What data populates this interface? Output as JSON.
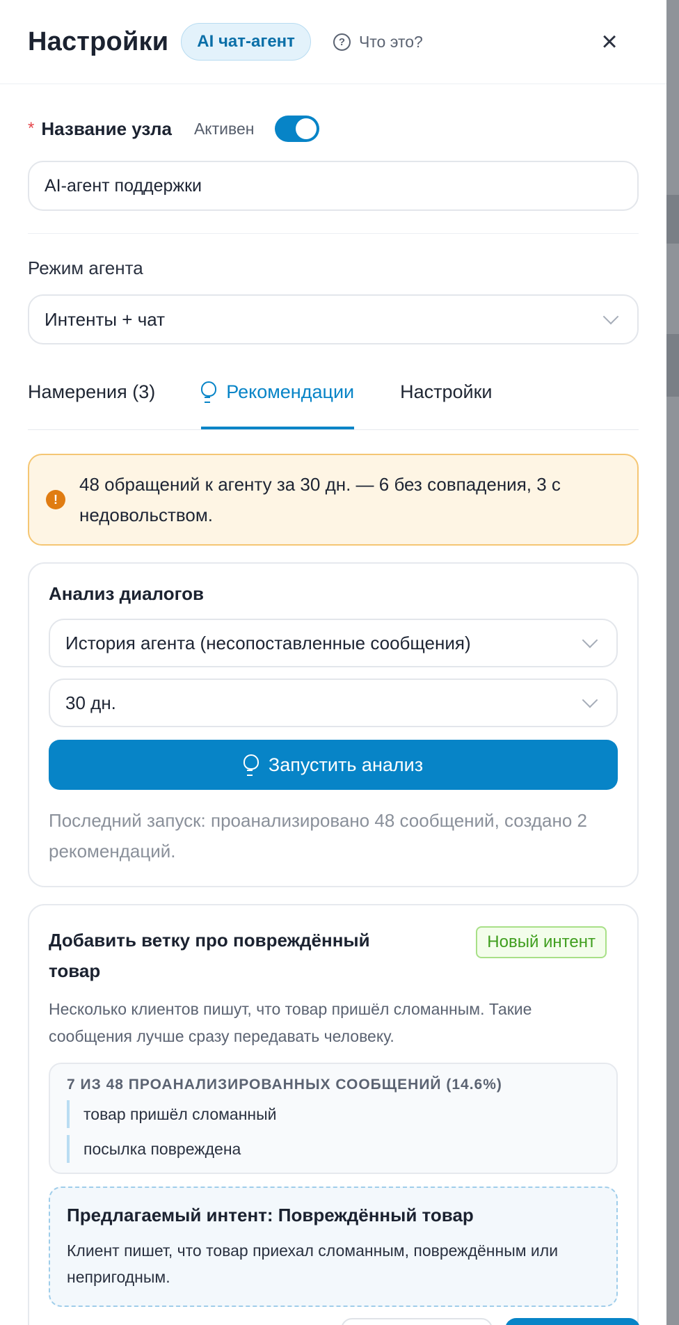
{
  "header": {
    "title": "Настройки",
    "badge": "AI чат-агент",
    "help_label": "Что это?"
  },
  "node": {
    "name_label": "Название узла",
    "active_label": "Активен",
    "active": true,
    "name_value": "AI-агент поддержки"
  },
  "mode": {
    "label": "Режим агента",
    "value": "Интенты + чат"
  },
  "tabs": [
    {
      "label": "Намерения (3)",
      "active": false
    },
    {
      "label": "Рекомендации",
      "active": true
    },
    {
      "label": "Настройки",
      "active": false
    }
  ],
  "alert": {
    "icon": "exclamation-icon",
    "text": "48 обращений к агенту за 30 дн. — 6 без совпадения, 3 с недовольством."
  },
  "analysis": {
    "title": "Анализ диалогов",
    "source": "История агента (несопоставленные сообщения)",
    "period": "30 дн.",
    "run_label": "Запустить анализ",
    "last_run": "Последний запуск: проанализировано 48 сообщений, создано 2 рекомендаций."
  },
  "recommendation": {
    "title": "Добавить ветку про повреждённый товар",
    "badge": "Новый интент",
    "description": "Несколько клиентов пишут, что товар пришёл сломанным. Такие сообщения лучше сразу передавать человеку.",
    "samples_header": "7 из 48 проанализированных сообщений (14.6%)",
    "samples": [
      "товар пришёл сломанный",
      "посылка повреждена"
    ],
    "proposed_title": "Предлагаемый интент: Повреждённый товар",
    "proposed_description": "Клиент пишет, что товар приехал сломанным, повреждённым или непригодным."
  },
  "colors": {
    "accent": "#0784c7",
    "warning_bg": "#fef5e4",
    "warning_border": "#f5c673",
    "success": "#3f9e1e"
  }
}
